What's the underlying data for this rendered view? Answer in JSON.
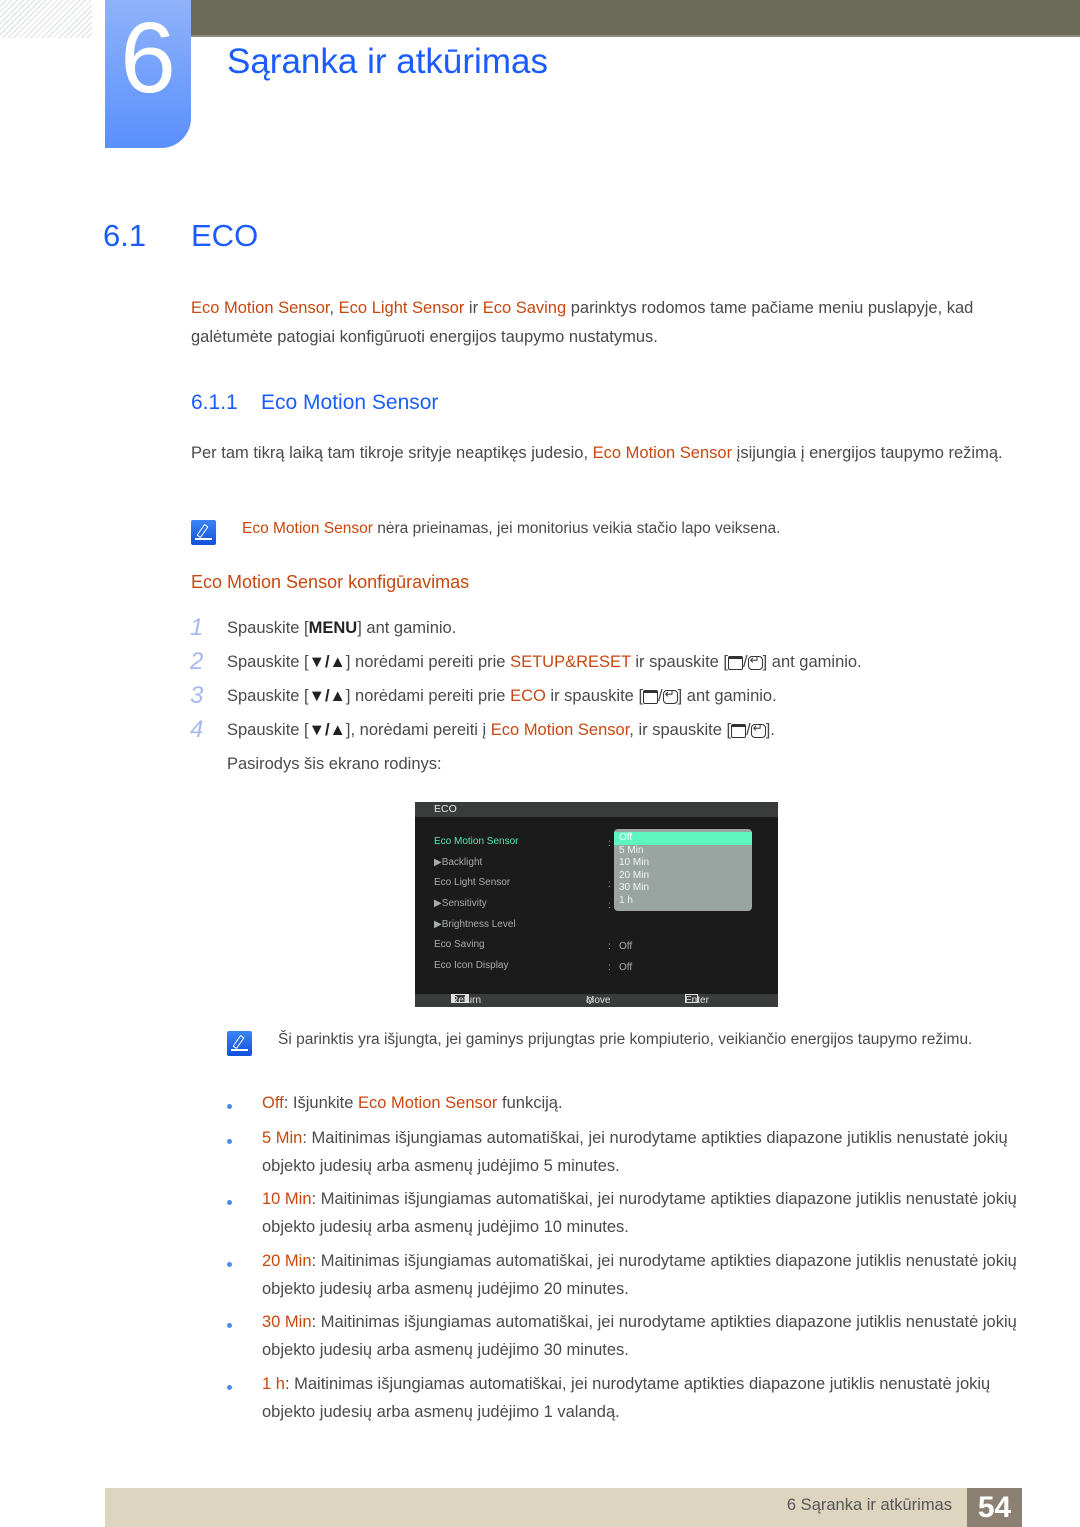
{
  "header": {
    "chapter_number": "6",
    "chapter_title": "Sąranka ir atkūrimas"
  },
  "section": {
    "number": "6.1",
    "title": "ECO",
    "intro": {
      "hl1": "Eco Motion Sensor",
      "sep1": ", ",
      "hl2": "Eco Light Sensor",
      "sep2": " ir ",
      "hl3": "Eco Saving",
      "rest": " parinktys rodomos tame pačiame meniu puslapyje, kad galėtumėte patogiai konfigūruoti energijos taupymo nustatymus."
    }
  },
  "subsection": {
    "number": "6.1.1",
    "title": "Eco Motion Sensor",
    "para_before": "Per tam tikrą laiką tam tikroje srityje neaptikęs judesio, ",
    "para_hl": "Eco Motion Sensor",
    "para_after": " įsijungia į energijos taupymo režimą.",
    "note1_hl": "Eco Motion Sensor",
    "note1_text": " nėra prieinamas, jei monitorius veikia stačio lapo veiksena.",
    "config_heading": "Eco Motion Sensor konfigūravimas"
  },
  "steps": [
    {
      "num": "1",
      "a": "Spauskite [",
      "key": "MENU",
      "b": "] ant gaminio."
    },
    {
      "num": "2",
      "a": "Spauskite [",
      "key": "▼/▲",
      "b": "] norėdami pereiti prie ",
      "hl": "SETUP&RESET",
      "c": " ir spauskite [",
      "d": "] ant gaminio."
    },
    {
      "num": "3",
      "a": "Spauskite [",
      "key": "▼/▲",
      "b": "] norėdami pereiti prie ",
      "hl": "ECO",
      "c": " ir spauskite [",
      "d": "] ant gaminio."
    },
    {
      "num": "4",
      "a": "Spauskite [",
      "key": "▼/▲",
      "b": "], norėdami pereiti į ",
      "hl": "Eco Motion Sensor",
      "c": ", ir spauskite [",
      "d": "]."
    }
  ],
  "screen_caption": "Pasirodys šis ekrano rodinys:",
  "osd": {
    "title": "ECO",
    "items": [
      {
        "label": "Eco Motion Sensor",
        "value": ""
      },
      {
        "label": "Backlight",
        "value": ""
      },
      {
        "label": "Eco Light Sensor",
        "value": ""
      },
      {
        "label": "Sensitivity",
        "value": ""
      },
      {
        "label": "Brightness Level",
        "value": ""
      },
      {
        "label": "Eco Saving",
        "value": "Off"
      },
      {
        "label": "Eco Icon Display",
        "value": "Off"
      }
    ],
    "dropdown_options": [
      "Off",
      "5 Min",
      "10 Min",
      "20 Min",
      "30 Min",
      "1 h"
    ],
    "selected_option": "Off",
    "footer": {
      "return": "Return",
      "move": "Move",
      "enter": "Enter"
    }
  },
  "note2": "Ši parinktis yra išjungta, jei gaminys prijungtas prie kompiuterio, veikiančio energijos taupymo režimu.",
  "bullets": [
    {
      "hl": "Off",
      "text": ": Išjunkite ",
      "hl2": "Eco Motion Sensor",
      "text2": " funkciją."
    },
    {
      "hl": "5 Min",
      "text": ": Maitinimas išjungiamas automatiškai, jei nurodytame aptikties diapazone jutiklis nenustatė jokių objekto judesių arba asmenų judėjimo 5 minutes."
    },
    {
      "hl": "10 Min",
      "text": ": Maitinimas išjungiamas automatiškai, jei nurodytame aptikties diapazone jutiklis nenustatė jokių objekto judesių arba asmenų judėjimo 10 minutes."
    },
    {
      "hl": "20 Min",
      "text": ": Maitinimas išjungiamas automatiškai, jei nurodytame aptikties diapazone jutiklis nenustatė jokių objekto judesių arba asmenų judėjimo 20 minutes."
    },
    {
      "hl": "30 Min",
      "text": ": Maitinimas išjungiamas automatiškai, jei nurodytame aptikties diapazone jutiklis nenustatė jokių objekto judesių arba asmenų judėjimo 30 minutes."
    },
    {
      "hl": "1 h",
      "text": ": Maitinimas išjungiamas automatiškai, jei nurodytame aptikties diapazone jutiklis nenustatė jokių objekto judesių arba asmenų judėjimo 1 valandą."
    }
  ],
  "footer": {
    "chapter_label": "6 Sąranka ir atkūrimas",
    "page_number": "54"
  },
  "colors": {
    "heading_blue": "#1a5cff",
    "highlight_orange": "#c8470f",
    "topbar": "#6c6b57",
    "footer_bg": "#ddd5c0",
    "page_badge": "#8b8071",
    "osd_active": "#59e6b0"
  }
}
